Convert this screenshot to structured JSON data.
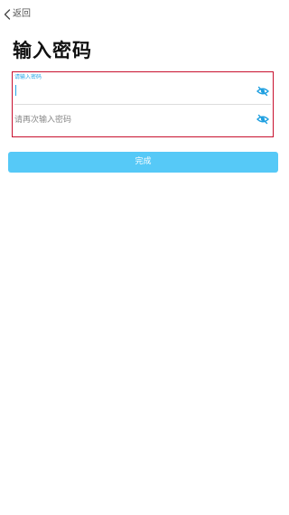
{
  "header": {
    "back_label": "返回",
    "back_icon": "chevron-left-icon"
  },
  "title": "输入密码",
  "form": {
    "password": {
      "label": "请输入密码",
      "value": "",
      "visibility_icon": "eye-off-icon"
    },
    "confirm_password": {
      "placeholder": "请再次输入密码",
      "value": "",
      "visibility_icon": "eye-off-icon"
    },
    "highlight_color": "#c8102e",
    "accent_color": "#2aa7e8"
  },
  "submit": {
    "label": "完成",
    "color": "#56c9f7"
  }
}
